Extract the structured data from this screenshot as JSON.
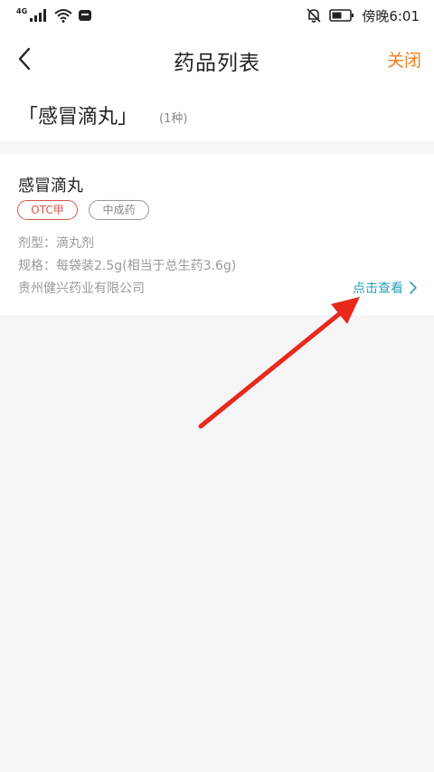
{
  "status_bar": {
    "network": "4G",
    "time": "傍晚6:01",
    "icons": [
      "signal-icon",
      "wifi-icon",
      "notification-app-icon",
      "bell-off-icon",
      "battery-icon"
    ]
  },
  "nav": {
    "back_icon": "chevron-left-icon",
    "title": "药品列表",
    "close_label": "关闭"
  },
  "header": {
    "search_term": "「感冒滴丸」",
    "result_count": "(1种)"
  },
  "results": [
    {
      "name": "感冒滴丸",
      "tags": [
        "OTC甲",
        "中成药"
      ],
      "dosage_form": "剂型：滴丸剂",
      "spec": "规格：每袋装2.5g(相当于总生药3.6g)",
      "manufacturer": "贵州健兴药业有限公司",
      "detail_label": "点击查看"
    }
  ],
  "colors": {
    "accent_orange": "#f07f1c",
    "tag_red": "#d9534f",
    "link_teal": "#2aa0b4",
    "arrow_red": "#e8291c"
  }
}
